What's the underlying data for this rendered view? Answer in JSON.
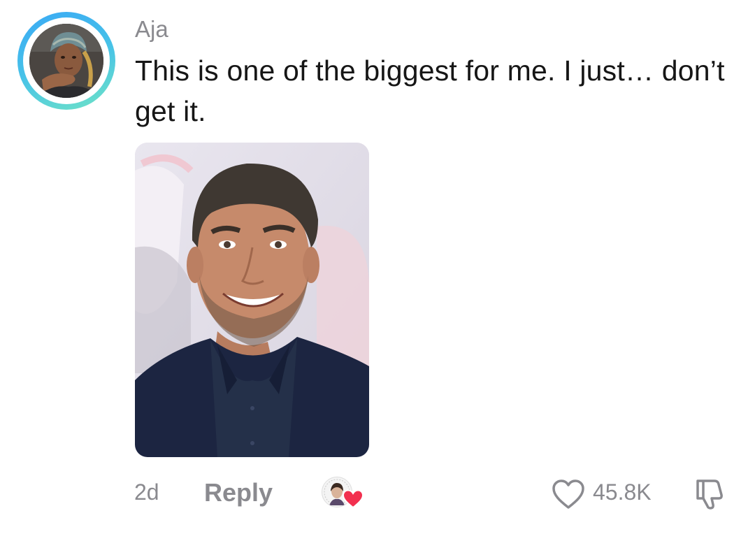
{
  "comment": {
    "username": "Aja",
    "text": "This is one of the biggest for me. I just… don’t get it.",
    "time_ago": "2d",
    "reply_label": "Reply",
    "like_count": "45.8K"
  },
  "icons": {
    "like": "heart-outline-icon",
    "dislike": "thumbs-down-icon",
    "creator_liked": "heart-filled-icon"
  },
  "colors": {
    "avatar_ring_start": "#3aa9f5",
    "avatar_ring_end": "#6fe3c6",
    "muted_text": "#8a8a8f",
    "body_text": "#161616",
    "heart_red": "#f2304f"
  }
}
